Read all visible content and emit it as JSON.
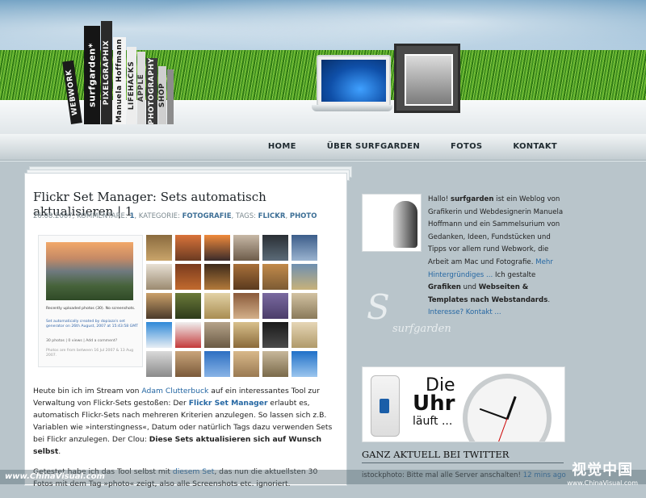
{
  "nav": {
    "home": "HOME",
    "about": "ÜBER SURFGARDEN",
    "fotos": "FOTOS",
    "kontakt": "KONTAKT"
  },
  "books": [
    "WEBWORK",
    "surfgarden*",
    "PIXELGRAPHIX",
    "Manuela Hoffmann",
    "LIFEHACKS",
    "APPLE",
    "PHOTOGRAPHY",
    "SHOP"
  ],
  "post": {
    "title": "Flickr Set Manager: Sets automatisch aktualisieren | 1",
    "date": "26.08.2007,",
    "comments_label": "KOMMENTARE:",
    "comments_count": "1",
    "category_label": ", KATEGORIE:",
    "category": "FOTOGRAFIE",
    "tags_label": ", TAGS:",
    "tag1": "FLICKR",
    "tag2": "PHOTO",
    "screenshot": {
      "cap1": "Recently uploaded photos (30). No screenshots.",
      "cap2": "Set automatically created by dopiaza's set generator on 26th August, 2007 at 15:43:58 GMT",
      "cap3": "30 photos | 0 views | Add a comment?",
      "cap4": "Photos are from between 16 Jul 2007 & 13 Aug 2007."
    },
    "p1": {
      "t1": "Heute bin ich im Stream von ",
      "link1": "Adam Clutterbuck",
      "t2": " auf ein interessantes Tool zur Verwaltung von Flickr-Sets gestoßen: Der ",
      "link2": "Flickr Set Manager",
      "t3": " erlaubt es, automatisch Flickr-Sets nach mehreren Kriterien anzulegen. So lassen sich z.B. Variablen wie »interstingness«, Datum oder natürlich Tags dazu verwenden Sets bei Flickr anzulegen. Der Clou: ",
      "bold": "Diese Sets aktualisieren sich auf Wunsch selbst",
      "t4": "."
    },
    "p2": {
      "t1": "Getestet habe ich das Tool selbst mit ",
      "link": "diesem Set",
      "t2": ", das nun die aktuellsten 30 Fotos mit dem Tag »photo« zeigt, also alle Screenshots etc. ignoriert."
    }
  },
  "sidebar": {
    "about": {
      "t1": "Hallo! ",
      "brand": "surfgarden",
      "t2": " ist ein Weblog von Grafikerin und Webdesignerin Manuela Hoffmann und ein Sammelsurium von Gedanken, Ideen, Fundstücken und Tipps vor allem rund Webwork, die Arbeit am Mac und Fotografie. ",
      "more": "Mehr Hintergründiges ...",
      "t3": " Ich gestalte ",
      "b1": "Grafiken",
      "t4": " und ",
      "b2": "Webseiten & Templates nach Webstandards",
      "t5": ". ",
      "interest": "Interesse? Kontakt ..."
    },
    "logo_letter": "S",
    "logo_text": "surfgarden",
    "uhr_line1": "Die",
    "uhr_line2": "Uhr",
    "uhr_line3": "läuft ...",
    "twitter_title": "GANZ AKTUELL BEI TWITTER",
    "twitter_text": "istockphoto: Bitte mal alle Server anschalten! ",
    "twitter_time": "12 mins ago"
  },
  "watermark": {
    "left": "www.ChinaVisual.com",
    "right_cn": "视觉中国",
    "right_en": "www.ChinaVisual.com"
  }
}
